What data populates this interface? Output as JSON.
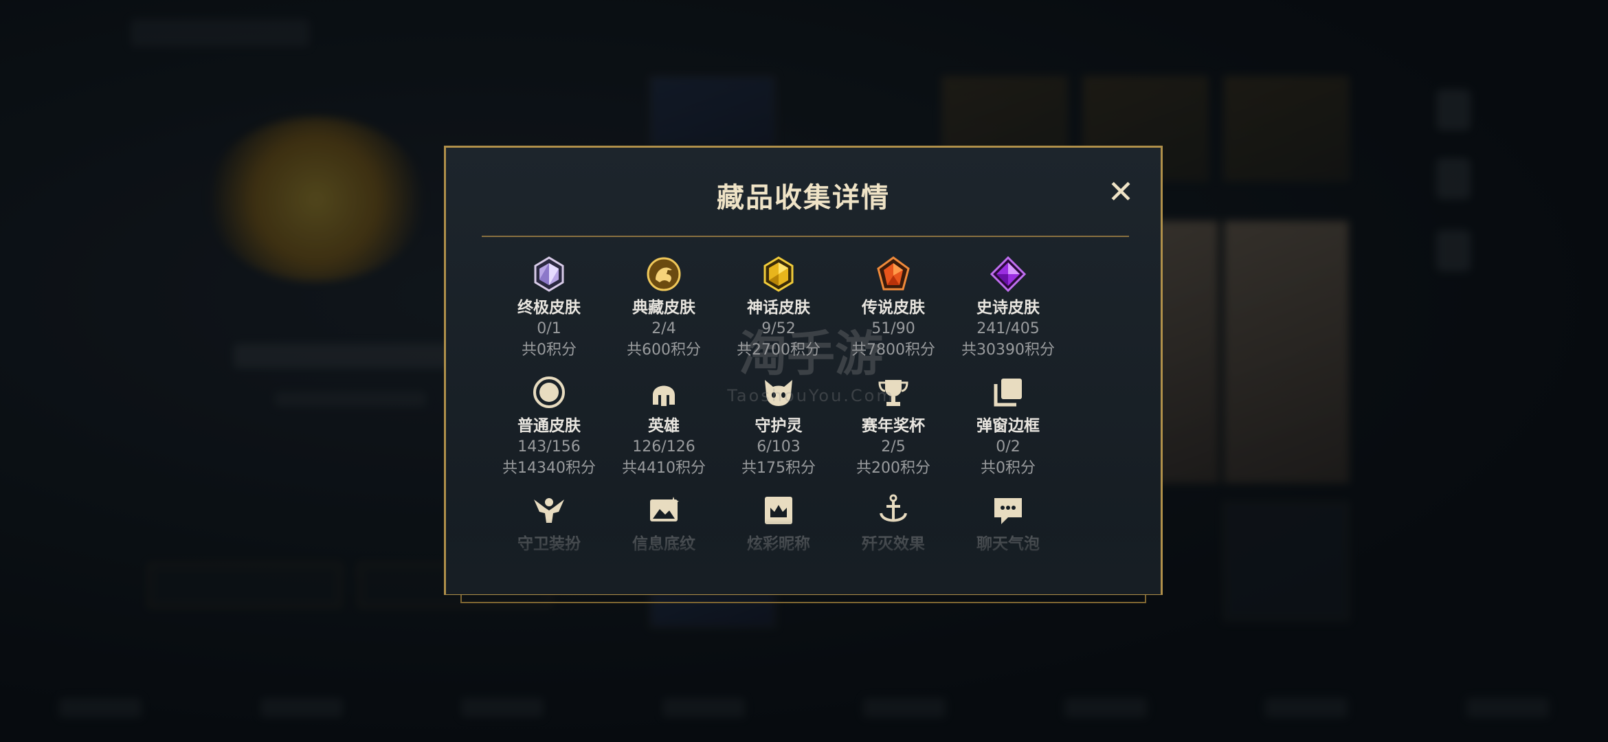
{
  "modal": {
    "title": "藏品收集详情",
    "close_symbol": "✕"
  },
  "categories": [
    {
      "name": "终极皮肤",
      "count": "0/1",
      "points": "共0积分",
      "icon": "ultimate-gem-icon"
    },
    {
      "name": "典藏皮肤",
      "count": "2/4",
      "points": "共600积分",
      "icon": "collection-dragon-icon"
    },
    {
      "name": "神话皮肤",
      "count": "9/52",
      "points": "共2700积分",
      "icon": "mythic-gem-icon"
    },
    {
      "name": "传说皮肤",
      "count": "51/90",
      "points": "共7800积分",
      "icon": "legend-gem-icon"
    },
    {
      "name": "史诗皮肤",
      "count": "241/405",
      "points": "共30390积分",
      "icon": "epic-gem-icon"
    },
    {
      "name": "普通皮肤",
      "count": "143/156",
      "points": "共14340积分",
      "icon": "normal-circle-icon"
    },
    {
      "name": "英雄",
      "count": "126/126",
      "points": "共4410积分",
      "icon": "hero-helmet-icon"
    },
    {
      "name": "守护灵",
      "count": "6/103",
      "points": "共175积分",
      "icon": "guardian-spirit-icon"
    },
    {
      "name": "赛年奖杯",
      "count": "2/5",
      "points": "共200积分",
      "icon": "trophy-icon"
    },
    {
      "name": "弹窗边框",
      "count": "0/2",
      "points": "共0积分",
      "icon": "popup-frame-icon"
    },
    {
      "name": "守卫装扮",
      "icon": "guard-outfit-icon"
    },
    {
      "name": "信息底纹",
      "icon": "info-pattern-icon"
    },
    {
      "name": "炫彩昵称",
      "icon": "colorful-nickname-icon"
    },
    {
      "name": "歼灭效果",
      "icon": "annihilation-effect-icon"
    },
    {
      "name": "聊天气泡",
      "icon": "chat-bubble-icon"
    }
  ],
  "watermark": {
    "main": "淘手游",
    "sub": "TaoshouYou.Com"
  },
  "colors": {
    "modal_border": "#b0904a",
    "title": "#efe3c6",
    "divider": "#8a7140"
  }
}
